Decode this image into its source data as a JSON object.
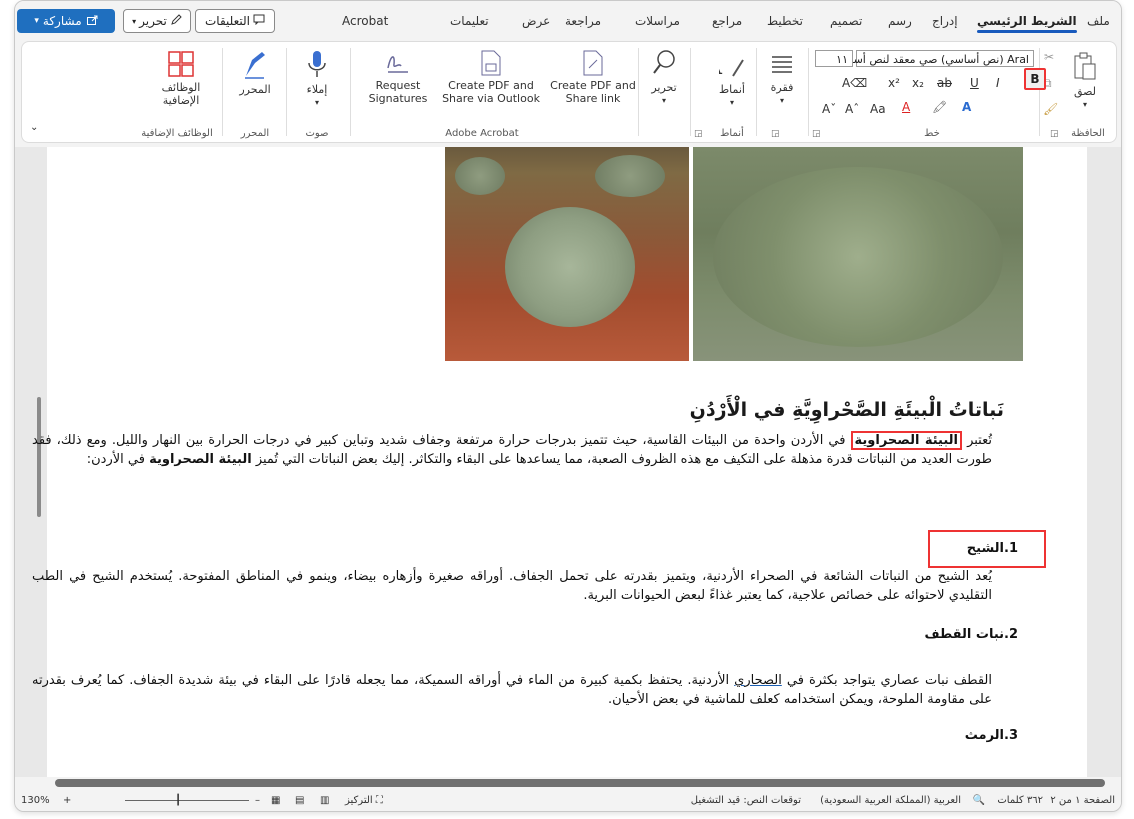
{
  "tabs": {
    "file": "ملف",
    "home": "الشريط الرئيسي",
    "insert": "إدراج",
    "draw": "رسم",
    "design": "تصميم",
    "layout": "تخطيط",
    "references": "مراجع",
    "mailings": "مراسلات",
    "review": "مراجعة",
    "view": "عرض",
    "help": "تعليمات",
    "acrobat": "Acrobat"
  },
  "top_buttons": {
    "comments": "التعليقات",
    "editing": "تحرير",
    "share": "مشاركة"
  },
  "ribbon": {
    "clipboard": {
      "paste": "لصق",
      "group": "الحافظة"
    },
    "font": {
      "name": "Aral (نص أساسي) صي معقد لنص أساسي",
      "size": "١١",
      "change_case": "Aa",
      "group": "خط"
    },
    "paragraph": {
      "label": "فقرة"
    },
    "styles": {
      "label": "أنماط",
      "group": "أنماط"
    },
    "editing": {
      "label": "تحرير"
    },
    "acrobat": {
      "share_link": "Create PDF and Share link",
      "share_outlook": "Create PDF and Share via Outlook",
      "request_sig": "Request Signatures",
      "group": "Adobe Acrobat"
    },
    "voice": {
      "dictate": "إملاء",
      "group": "صوت"
    },
    "editor": {
      "label": "المحرر",
      "group": "المحرر"
    },
    "addins": {
      "label": "الوظائف الإضافية",
      "group": "الوظائف الإضافية"
    }
  },
  "document": {
    "title": "نَباتاتُ الْبيئَةِ الصَّحْراوِيَّةِ في الْأَرْدُنِ",
    "p1_a": "تُعتبر",
    "p1_hl": "البيئة الصحراوية",
    "p1_b": "في الأردن واحدة من البيئات القاسية، حيث تتميز بدرجات حرارة مرتفعة وجفاف شديد وتباين كبير في درجات الحرارة بين النهار والليل. ومع ذلك، فقد طورت العديد من النباتات قدرة مذهلة على التكيف مع هذه الظروف الصعبة، مما يساعدها على البقاء والتكاثر. إليك بعض النباتات التي تُميز",
    "p1_bold": "البيئة الصحراوية",
    "p1_c": "في الأردن:",
    "sub1": "1.الشيح",
    "p2": "يُعد الشيح من النباتات الشائعة في الصحراء الأردنية، ويتميز بقدرته على تحمل الجفاف. أوراقه صغيرة وأزهاره بيضاء، وينمو في المناطق المفتوحة. يُستخدم الشيح في الطب التقليدي لاحتوائه على خصائص علاجية، كما يعتبر غذاءً لبعض الحيوانات البرية.",
    "sub2": "2.نبات القطف",
    "p3_a": "القطف نبات عصاري يتواجد بكثرة في",
    "p3_link": "الصحاري",
    "p3_b": "الأردنية. يحتفظ بكمية كبيرة من الماء في أوراقه السميكة، مما يجعله قادرًا على البقاء في بيئة شديدة الجفاف. كما يُعرف بقدرته على مقاومة الملوحة، ويمكن استخدامه كعلف للماشية في بعض الأحيان.",
    "sub3": "3.الرمث"
  },
  "status": {
    "page": "الصفحة ١ من ٢",
    "words": "٣٦٢ كلمات",
    "language": "العربية (المملكة العربية السعودية)",
    "predictions": "توقعات النص: قيد التشغيل",
    "focus": "التركيز",
    "zoom": "130%"
  },
  "colors": {
    "accent": "#185abd",
    "share": "#1f6fbf",
    "highlight": "#e33333"
  }
}
